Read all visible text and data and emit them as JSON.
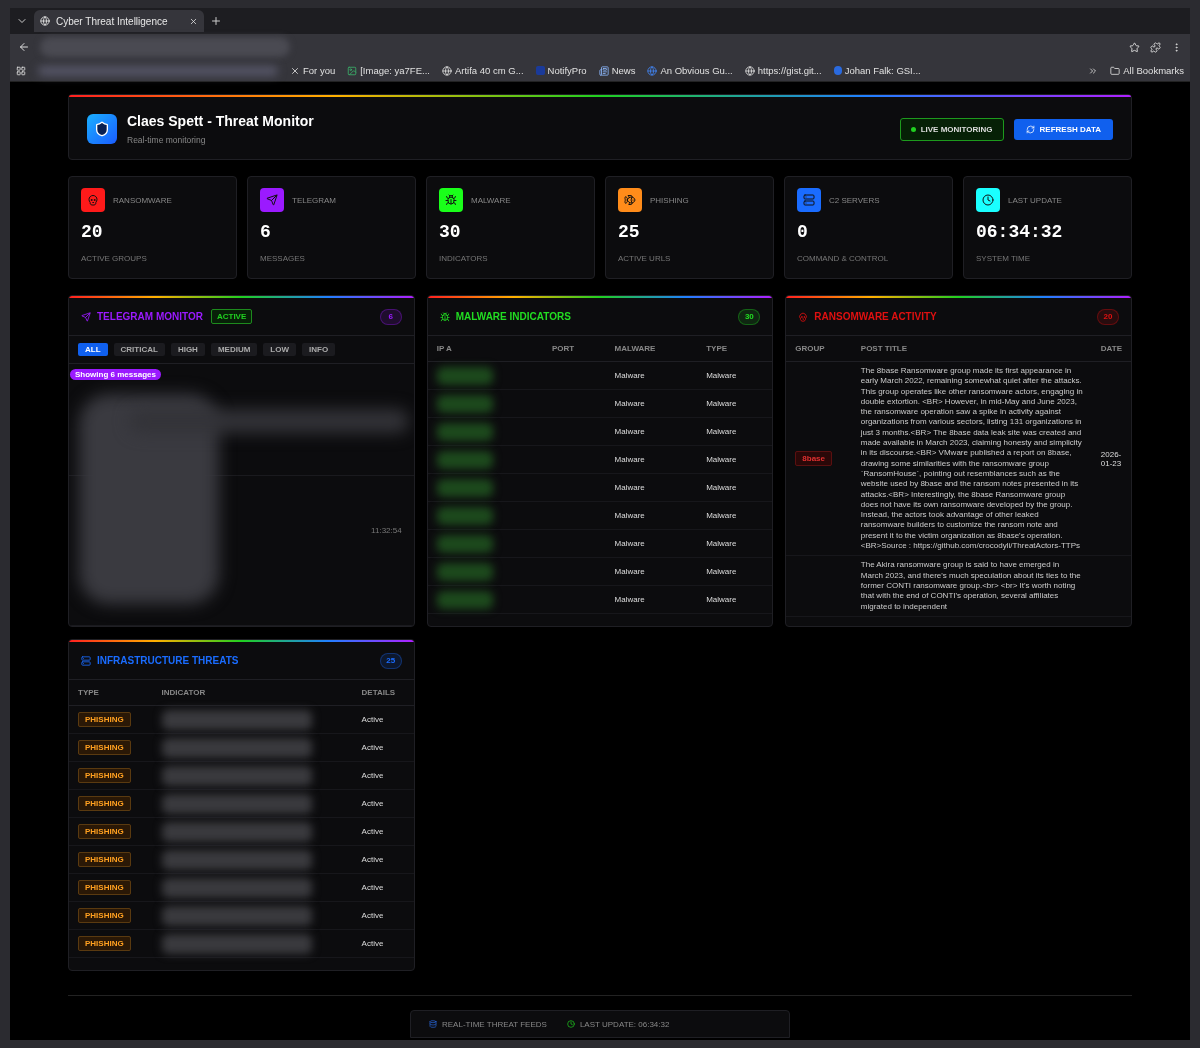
{
  "browser": {
    "tab_title": "Cyber Threat Intelligence",
    "bookmarks": [
      {
        "label": "For you",
        "kind": "x"
      },
      {
        "label": "[Image: ya7FE...",
        "kind": "image"
      },
      {
        "label": "Artifa 40 cm G...",
        "kind": "globe"
      },
      {
        "label": "NotifyPro",
        "kind": "n"
      },
      {
        "label": "News",
        "kind": "news"
      },
      {
        "label": "An Obvious Gu...",
        "kind": "google"
      },
      {
        "label": "https://gist.git...",
        "kind": "globe"
      },
      {
        "label": "Johan Falk: GSI...",
        "kind": "s"
      }
    ],
    "all_bookmarks": "All Bookmarks"
  },
  "header": {
    "title": "Claes Spett - Threat Monitor",
    "subtitle": "Real-time monitoring",
    "live_label": "LIVE MONITORING",
    "refresh_label": "REFRESH DATA"
  },
  "stats": [
    {
      "label": "RANSOMWARE",
      "value": "20",
      "sub": "ACTIVE GROUPS",
      "color": "#ff1a1a",
      "kind": "skull"
    },
    {
      "label": "TELEGRAM",
      "value": "6",
      "sub": "MESSAGES",
      "color": "#9b1aff",
      "kind": "send"
    },
    {
      "label": "MALWARE",
      "value": "30",
      "sub": "INDICATORS",
      "color": "#1aff1a",
      "kind": "bug"
    },
    {
      "label": "PHISHING",
      "value": "25",
      "sub": "ACTIVE URLS",
      "color": "#ff8c1a",
      "kind": "fish"
    },
    {
      "label": "C2 SERVERS",
      "value": "0",
      "sub": "COMMAND & CONTROL",
      "color": "#1a6cff",
      "kind": "server"
    },
    {
      "label": "LAST UPDATE",
      "value": "06:34:32",
      "sub": "SYSTEM TIME",
      "color": "#1affff",
      "kind": "clock"
    }
  ],
  "telegram": {
    "title": "TELEGRAM MONITOR",
    "status": "ACTIVE",
    "count": "6",
    "filters": [
      {
        "label": "ALL",
        "selected": true
      },
      {
        "label": "CRITICAL",
        "selected": false
      },
      {
        "label": "HIGH",
        "selected": false
      },
      {
        "label": "MEDIUM",
        "selected": false
      },
      {
        "label": "LOW",
        "selected": false
      },
      {
        "label": "INFO",
        "selected": false
      }
    ],
    "showing": "Showing 6 messages",
    "message_times": [
      "11:32:54"
    ]
  },
  "malware": {
    "title": "MALWARE INDICATORS",
    "count": "30",
    "columns": [
      "IP A",
      "PORT",
      "MALWARE",
      "TYPE"
    ],
    "rows": [
      {
        "malware": "Malware",
        "type": "Malware"
      },
      {
        "malware": "Malware",
        "type": "Malware"
      },
      {
        "malware": "Malware",
        "type": "Malware"
      },
      {
        "malware": "Malware",
        "type": "Malware"
      },
      {
        "malware": "Malware",
        "type": "Malware"
      },
      {
        "malware": "Malware",
        "type": "Malware"
      },
      {
        "malware": "Malware",
        "type": "Malware"
      },
      {
        "malware": "Malware",
        "type": "Malware"
      },
      {
        "malware": "Malware",
        "type": "Malware"
      }
    ]
  },
  "ransomware": {
    "title": "RANSOMWARE ACTIVITY",
    "count": "20",
    "columns": [
      "GROUP",
      "POST TITLE",
      "DATE"
    ],
    "rows": [
      {
        "group": "8base",
        "post": "The 8base Ransomware group made its first appearance in early March 2022, remaining somewhat quiet after the attacks. This group operates like other ransomware actors, engaging in double extortion. <BR> However, in mid-May and June 2023, the ransomware operation saw a spike in activity against organizations from various sectors, listing 131 organizations in just 3 months.<BR> The 8base data leak site was created and made available in March 2023, claiming honesty and simplicity in its discourse.<BR> VMware published a report on 8base, drawing some similarities with the ransomware group `RansomHouse`, pointing out resemblances such as the website used by 8base and the ransom notes presented in its attacks.<BR> Interestingly, the 8base Ransomware group does not have its own ransomware developed by the group. Instead, the actors took advantage of other leaked ransomware builders to customize the ransom note and present it to the victim organization as 8base's operation.<BR>Source : https://github.com/crocodyli/ThreatActors-TTPs",
        "date": "2026-01-23"
      },
      {
        "post": "The Akira ransomware group is said to have emerged in March 2023, and there's much speculation about its ties to the former CONTI ransomware group.<br> <br> It's worth noting that with the end of CONTI's operation, several affiliates migrated to independent"
      }
    ]
  },
  "infrastructure": {
    "title": "INFRASTRUCTURE THREATS",
    "count": "25",
    "columns": [
      "TYPE",
      "INDICATOR",
      "DETAILS"
    ],
    "rows": [
      {
        "type": "PHISHING",
        "details": "Active"
      },
      {
        "type": "PHISHING",
        "details": "Active"
      },
      {
        "type": "PHISHING",
        "details": "Active"
      },
      {
        "type": "PHISHING",
        "details": "Active"
      },
      {
        "type": "PHISHING",
        "details": "Active"
      },
      {
        "type": "PHISHING",
        "details": "Active"
      },
      {
        "type": "PHISHING",
        "details": "Active"
      },
      {
        "type": "PHISHING",
        "details": "Active"
      },
      {
        "type": "PHISHING",
        "details": "Active"
      }
    ]
  },
  "footer": {
    "feeds": "REAL-TIME THREAT FEEDS",
    "last_update": "LAST UPDATE: 06:34:32"
  }
}
